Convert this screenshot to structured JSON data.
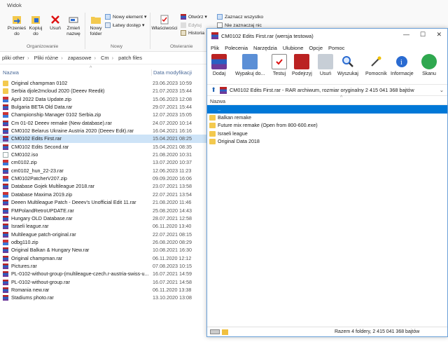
{
  "ribbon": {
    "tab": "Widok",
    "copy_path_label": "Przenieś do",
    "copy_to_label": "Kopiuj do",
    "delete_label": "Usuń",
    "rename_label": "Zmień nazwę",
    "new_folder_label": "Nowy folder",
    "new_item_label": "Nowy element ▾",
    "easy_access_label": "Łatwy dostęp ▾",
    "properties_label": "Właściwości",
    "open_label": "Otwórz ▾",
    "edit_label": "Edytuj",
    "history_label": "Historia",
    "select_all_label": "Zaznacz wszystko",
    "select_none_label": "Nie zaznaczaj nic",
    "group_organize": "Organizowanie",
    "group_new": "Nowy",
    "group_open": "Otwieranie"
  },
  "address": {
    "crumbs": [
      "pliki other",
      "Pliki różne",
      "zapasowe",
      "Cm",
      "patch files"
    ]
  },
  "columns": {
    "name": "Nazwa",
    "date": "Data modyfikacji"
  },
  "files": [
    {
      "name": "Original champman 0102",
      "date": "23.06.2023 10:59",
      "type": "folder"
    },
    {
      "name": "Serbia djole2mcloud 2020 (Deeev Reedit)",
      "date": "21.07.2023 15:44",
      "type": "folder"
    },
    {
      "name": "April 2022 Data Update.zip",
      "date": "15.06.2023 12:08",
      "type": "zip"
    },
    {
      "name": "Bulgaria BETA Old Data.rar",
      "date": "29.07.2021 15:44",
      "type": "rar"
    },
    {
      "name": "Championship Manager 0102 Serbia.zip",
      "date": "12.07.2023 15:05",
      "type": "zip"
    },
    {
      "name": "Cm 01-02 Deeev remake (New database).rar",
      "date": "24.07.2020 10:14",
      "type": "rar"
    },
    {
      "name": "CM0102 Belarus Ukraine Austria 2020 (Deeev Edit).rar",
      "date": "16.04.2021 16:16",
      "type": "rar"
    },
    {
      "name": "CM0102 Edits First.rar",
      "date": "15.04.2021 08:25",
      "type": "rar",
      "selected": true
    },
    {
      "name": "CM0102 Edits Second.rar",
      "date": "15.04.2021 08:35",
      "type": "rar"
    },
    {
      "name": "CM0102.iso",
      "date": "21.08.2020 10:31",
      "type": "iso"
    },
    {
      "name": "cm0102.zip",
      "date": "13.07.2020 10:37",
      "type": "zip"
    },
    {
      "name": "cm0102_hun_22-23.rar",
      "date": "12.06.2023 11:23",
      "type": "rar"
    },
    {
      "name": "CM0102PatcherV207.zip",
      "date": "09.09.2020 16:06",
      "type": "zip"
    },
    {
      "name": "Database Gojek Multileague 2018.rar",
      "date": "23.07.2021 13:58",
      "type": "rar"
    },
    {
      "name": "Database Maxima 2019.zip",
      "date": "22.07.2021 13:54",
      "type": "zip"
    },
    {
      "name": "Deeen Multileague Patch - Deeev's Unofficial Edit 11.rar",
      "date": "21.08.2020 11:46",
      "type": "rar"
    },
    {
      "name": "FMPolandRetroUPDATE.rar",
      "date": "25.08.2020 14:43",
      "type": "rar"
    },
    {
      "name": "Hungary OLD Database.rar",
      "date": "28.07.2021 12:58",
      "type": "rar"
    },
    {
      "name": "Israeli league.rar",
      "date": "06.11.2020 13:40",
      "type": "rar"
    },
    {
      "name": "Multileague patch-original.rar",
      "date": "22.07.2021 08:15",
      "type": "rar"
    },
    {
      "name": "odbg110.zip",
      "date": "26.08.2020 08:29",
      "type": "zip"
    },
    {
      "name": "Original Balkan & Hungary New.rar",
      "date": "10.08.2021 16:30",
      "type": "rar"
    },
    {
      "name": "Original champman.rar",
      "date": "06.11.2020 12:12",
      "type": "rar"
    },
    {
      "name": "Pictures.rar",
      "date": "07.08.2023 10:15",
      "type": "rar"
    },
    {
      "name": "PL-0102-without-group-(multileague-czech.r-austria-swiss-u...",
      "date": "16.07.2021 14:59",
      "type": "rar"
    },
    {
      "name": "PL-0102-without-group.rar",
      "date": "16.07.2021 14:58",
      "type": "rar"
    },
    {
      "name": "Romania new.rar",
      "date": "06.11.2020 13:38",
      "type": "rar"
    },
    {
      "name": "Stadiums photo.rar",
      "date": "13.10.2020 13:08",
      "type": "rar"
    }
  ],
  "winrar": {
    "title": "CM0102 Edits First.rar (wersja testowa)",
    "menu": [
      "Plik",
      "Polecenia",
      "Narzędzia",
      "Ulubione",
      "Opcje",
      "Pomoc"
    ],
    "tools": [
      "Dodaj",
      "Wypakuj do...",
      "Testuj",
      "Podejrzyj",
      "Usuń",
      "Wyszukaj",
      "Pomocnik",
      "Informacje",
      "Skanu"
    ],
    "path": "CM0102 Edits First.rar - RAR archiwum, rozmiar oryginalny 2 415 041 368 bajtów",
    "column_name": "Nazwa",
    "entries": [
      "..",
      "Balkan remake",
      "Future mix remake (Open from 800-600.exe)",
      "Israeli league",
      "Original Data 2018"
    ],
    "status": "Razem 4 foldery, 2 415 041 368 bajtów",
    "colors": {
      "selection": "#0078d7",
      "folder": "#f3c94e"
    }
  }
}
